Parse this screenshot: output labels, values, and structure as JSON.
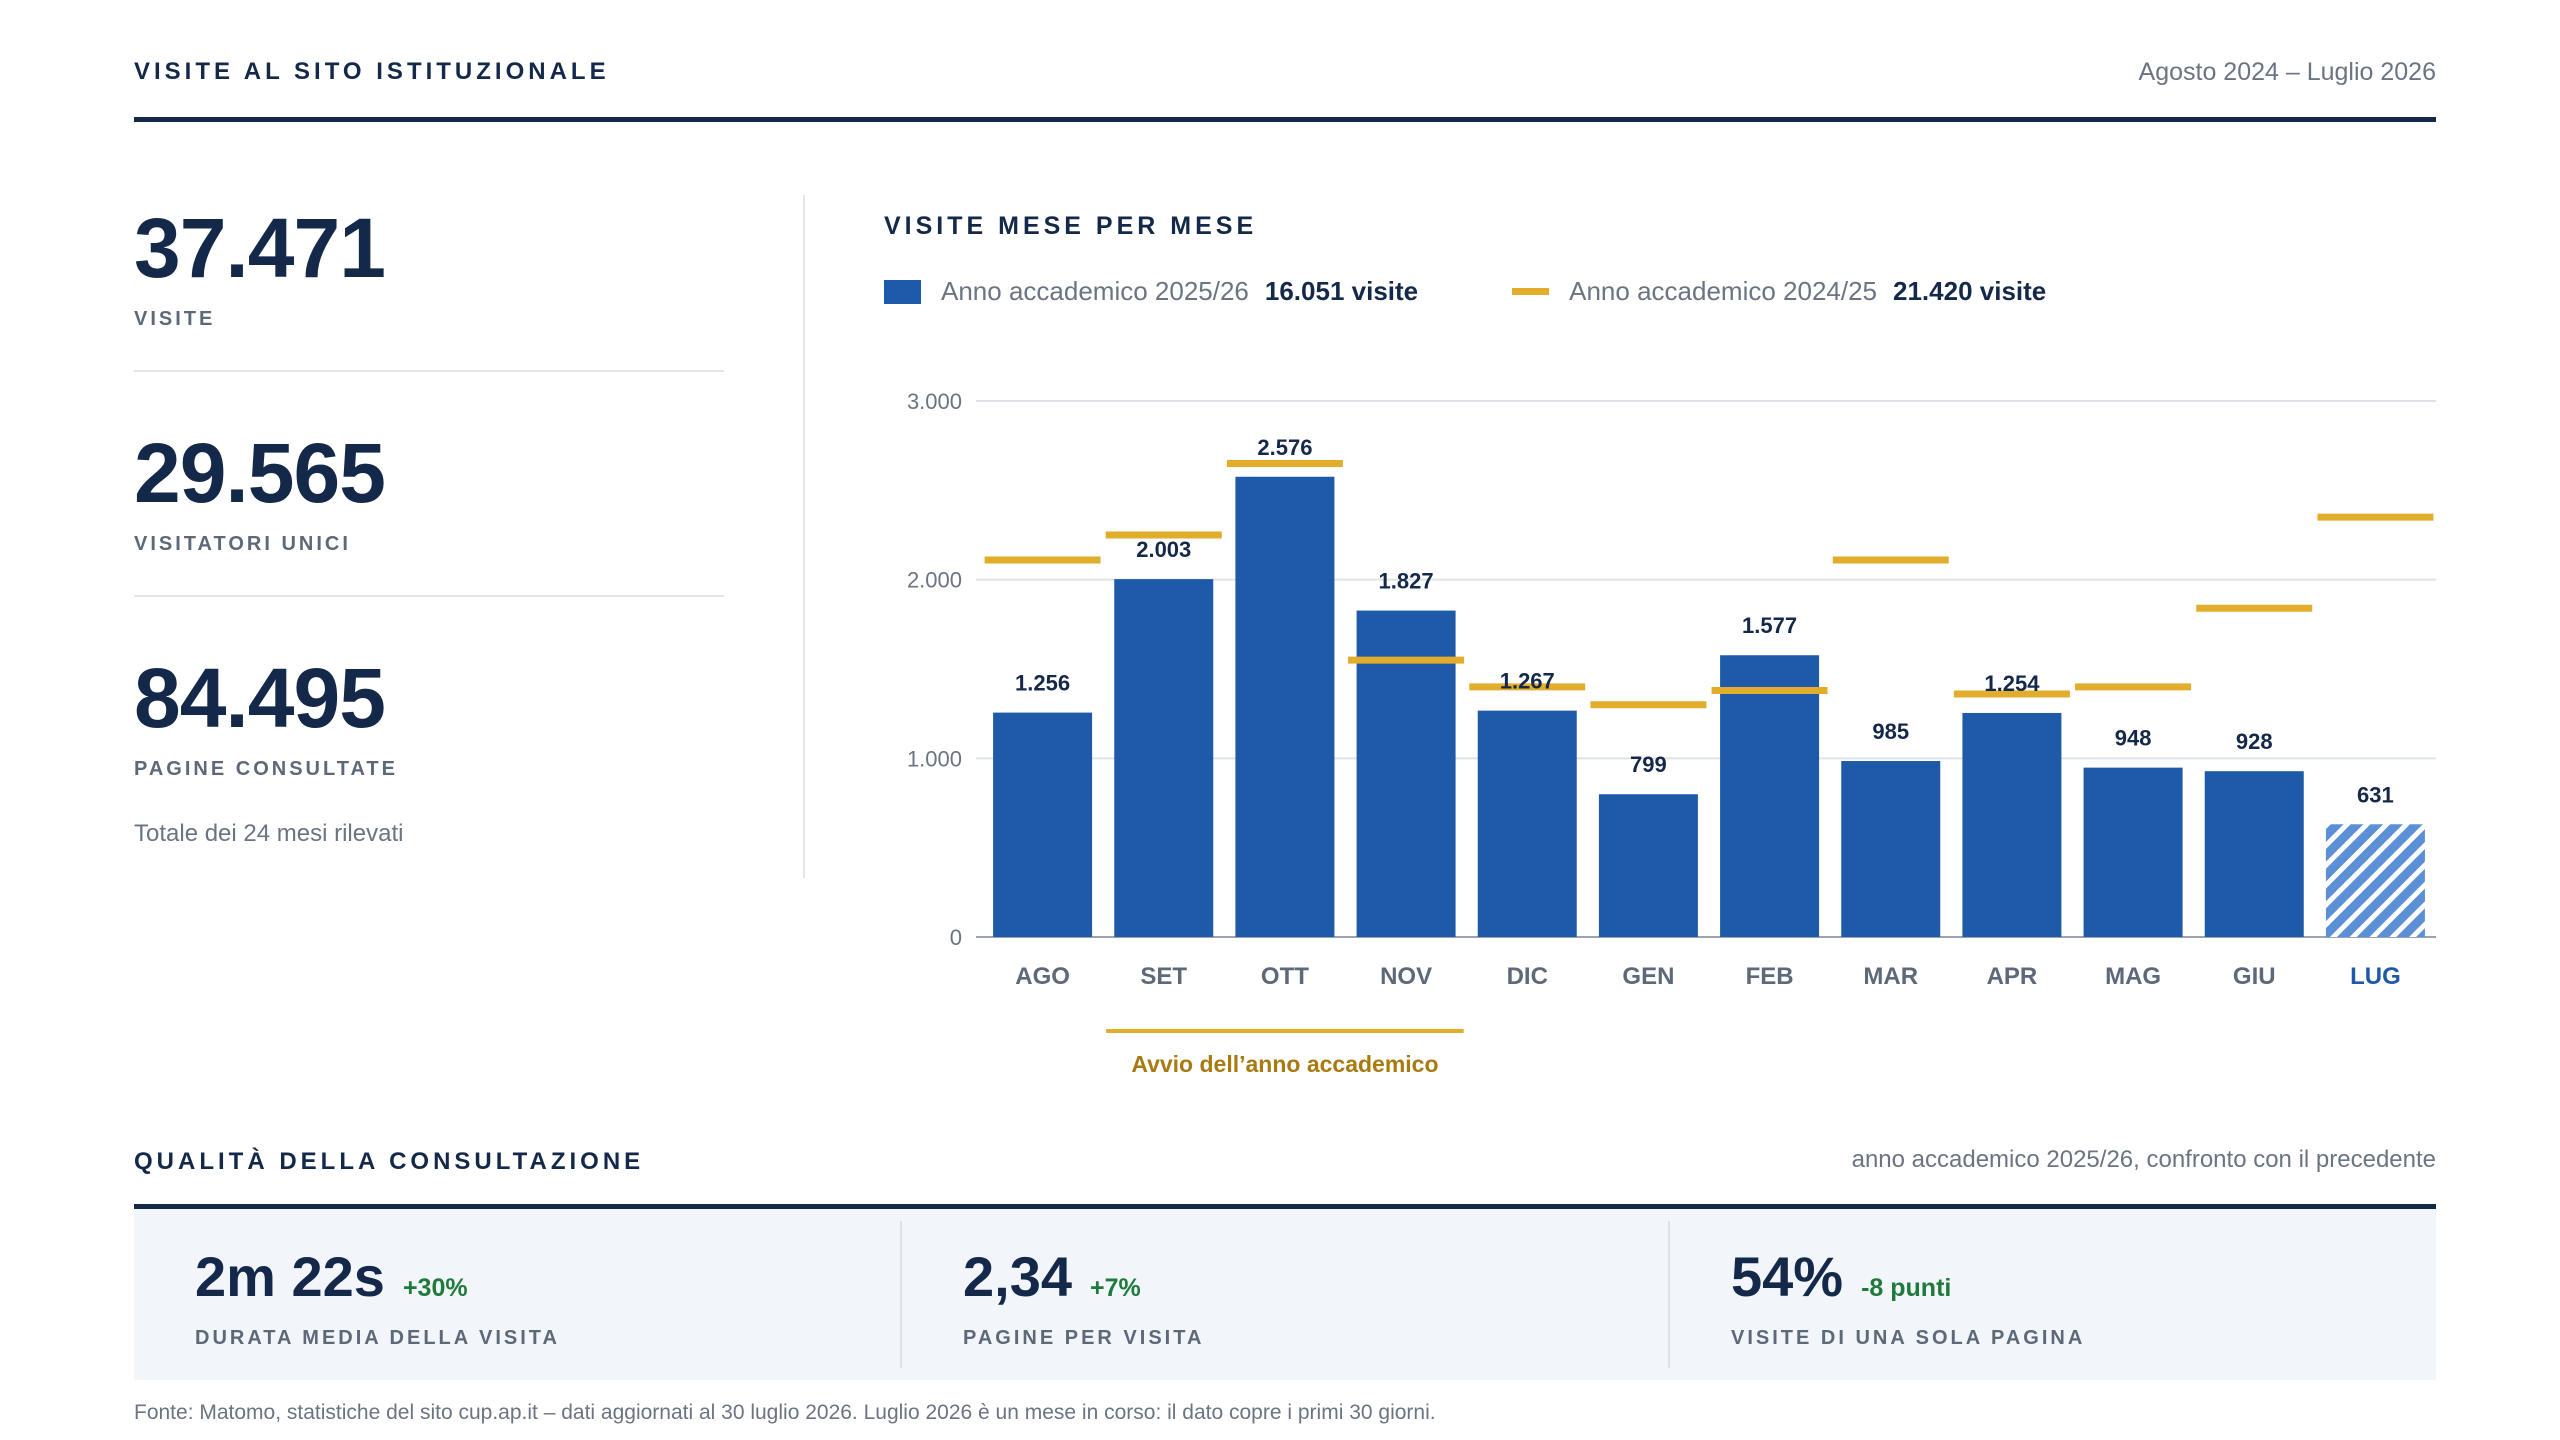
{
  "header": {
    "title": "VISITE AL SITO ISTITUZIONALE",
    "range": "Agosto 2024 – Luglio 2026"
  },
  "kpis": [
    {
      "value": "37.471",
      "label": "VISITE"
    },
    {
      "value": "29.565",
      "label": "VISITATORI UNICI"
    },
    {
      "value": "84.495",
      "label": "PAGINE CONSULTATE"
    }
  ],
  "kpi_note": "Totale dei 24 mesi rilevati",
  "chart_data": {
    "type": "bar",
    "title": "VISITE MESE PER MESE",
    "categories": [
      "AGO",
      "SET",
      "OTT",
      "NOV",
      "DIC",
      "GEN",
      "FEB",
      "MAR",
      "APR",
      "MAG",
      "GIU",
      "LUG"
    ],
    "series": [
      {
        "name": "Anno accademico 2025/26",
        "total_label": "16.051 visite",
        "mark": "bar",
        "color": "#1f5aa8",
        "values": [
          1256,
          2003,
          2576,
          1827,
          1267,
          799,
          1577,
          985,
          1254,
          948,
          928,
          631
        ],
        "value_labels": [
          "1.256",
          "2.003",
          "2.576",
          "1.827",
          "1.267",
          "799",
          "1.577",
          "985",
          "1.254",
          "948",
          "928",
          "631"
        ],
        "partial_last": true
      },
      {
        "name": "Anno accademico 2024/25",
        "total_label": "21.420 visite",
        "mark": "line-marker",
        "color": "#e2ad2b",
        "values": [
          2110,
          2250,
          2650,
          1550,
          1400,
          1300,
          1380,
          2110,
          1360,
          1400,
          1840,
          2350
        ]
      }
    ],
    "ylim": [
      0,
      3000
    ],
    "yticks": [
      0,
      1000,
      2000,
      3000
    ],
    "ytick_labels": [
      "0",
      "1.000",
      "2.000",
      "3.000"
    ],
    "grid": true,
    "highlight_category": "LUG",
    "annotation": {
      "text": "Avvio dell’anno accademico",
      "from": "SET",
      "to": "NOV"
    }
  },
  "quality": {
    "title": "QUALITÀ DELLA CONSULTAZIONE",
    "subtitle": "anno accademico 2025/26, confronto con il precedente",
    "metrics": [
      {
        "value": "2m 22s",
        "delta": "+30%",
        "label": "DURATA MEDIA DELLA VISITA"
      },
      {
        "value": "2,34",
        "delta": "+7%",
        "label": "PAGINE PER VISITA"
      },
      {
        "value": "54%",
        "delta": "-8 punti",
        "label": "VISITE DI UNA SOLA PAGINA"
      }
    ]
  },
  "footer": "Fonte: Matomo, statistiche del sito cup.ap.it – dati aggiornati al 30 luglio 2026. Luglio 2026 è un mese in corso: il dato copre i primi 30 giorni.",
  "colors": {
    "navy": "#14294a",
    "bar_blue": "#1f5aa8",
    "highlight_blue": "#5b8fd6",
    "gold": "#e2ad2b",
    "gold_text": "#a87a10",
    "positive": "#1f7a3c"
  }
}
